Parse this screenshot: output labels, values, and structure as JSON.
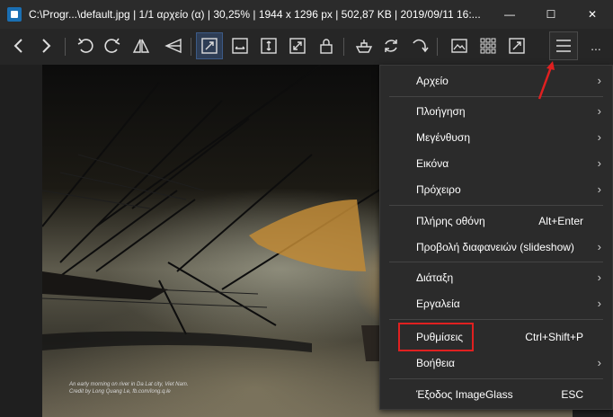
{
  "window": {
    "title": "C:\\Progr...\\default.jpg  |  1/1 αρχείο (α)  |  30,25%  |  1944 x 1296 px  |  502,87 KB  |  2019/09/11 16:...",
    "minimize_glyph": "—",
    "maximize_glyph": "☐",
    "close_glyph": "✕"
  },
  "toolbar": {
    "more_label": "...",
    "icons": [
      "previous-icon",
      "next-icon",
      "rotate-left-icon",
      "rotate-right-icon",
      "flip-horizontal-icon",
      "flip-vertical-icon",
      "auto-zoom-icon",
      "scale-to-width-icon",
      "scale-to-height-icon",
      "scale-to-fit-icon",
      "lock-zoom-icon",
      "scale-to-fill-icon",
      "refresh-icon",
      "goto-icon",
      "thumbnail-bar-icon",
      "checkerboard-icon",
      "fullscreen-icon",
      "main-menu-icon"
    ]
  },
  "photo": {
    "credit_line1": "An early morning on river in Da Lat city, Viet Nam.",
    "credit_line2": "Credit by Long Quang Le, fb.com/long.q.le"
  },
  "menu": {
    "items": [
      {
        "label": "Αρχείο",
        "shortcut": "",
        "submenu": true
      },
      {
        "label": "Πλοήγηση",
        "shortcut": "",
        "submenu": true
      },
      {
        "label": "Μεγένθυση",
        "shortcut": "",
        "submenu": true
      },
      {
        "label": "Εικόνα",
        "shortcut": "",
        "submenu": true
      },
      {
        "label": "Πρόχειρο",
        "shortcut": "",
        "submenu": true
      },
      {
        "label": "Πλήρης οθόνη",
        "shortcut": "Alt+Enter",
        "submenu": false
      },
      {
        "label": "Προβολή διαφανειών (slideshow)",
        "shortcut": "",
        "submenu": true
      },
      {
        "label": "Διάταξη",
        "shortcut": "",
        "submenu": true
      },
      {
        "label": "Εργαλεία",
        "shortcut": "",
        "submenu": true
      },
      {
        "label": "Ρυθμίσεις",
        "shortcut": "Ctrl+Shift+P",
        "submenu": false
      },
      {
        "label": "Βοήθεια",
        "shortcut": "",
        "submenu": true
      },
      {
        "label": "Έξοδος ImageGlass",
        "shortcut": "ESC",
        "submenu": false
      }
    ],
    "submenu_arrow": "›"
  },
  "colors": {
    "highlight_box": "#e02020",
    "annotation_arrow": "#e02020",
    "active_button": "#2e3d55"
  }
}
